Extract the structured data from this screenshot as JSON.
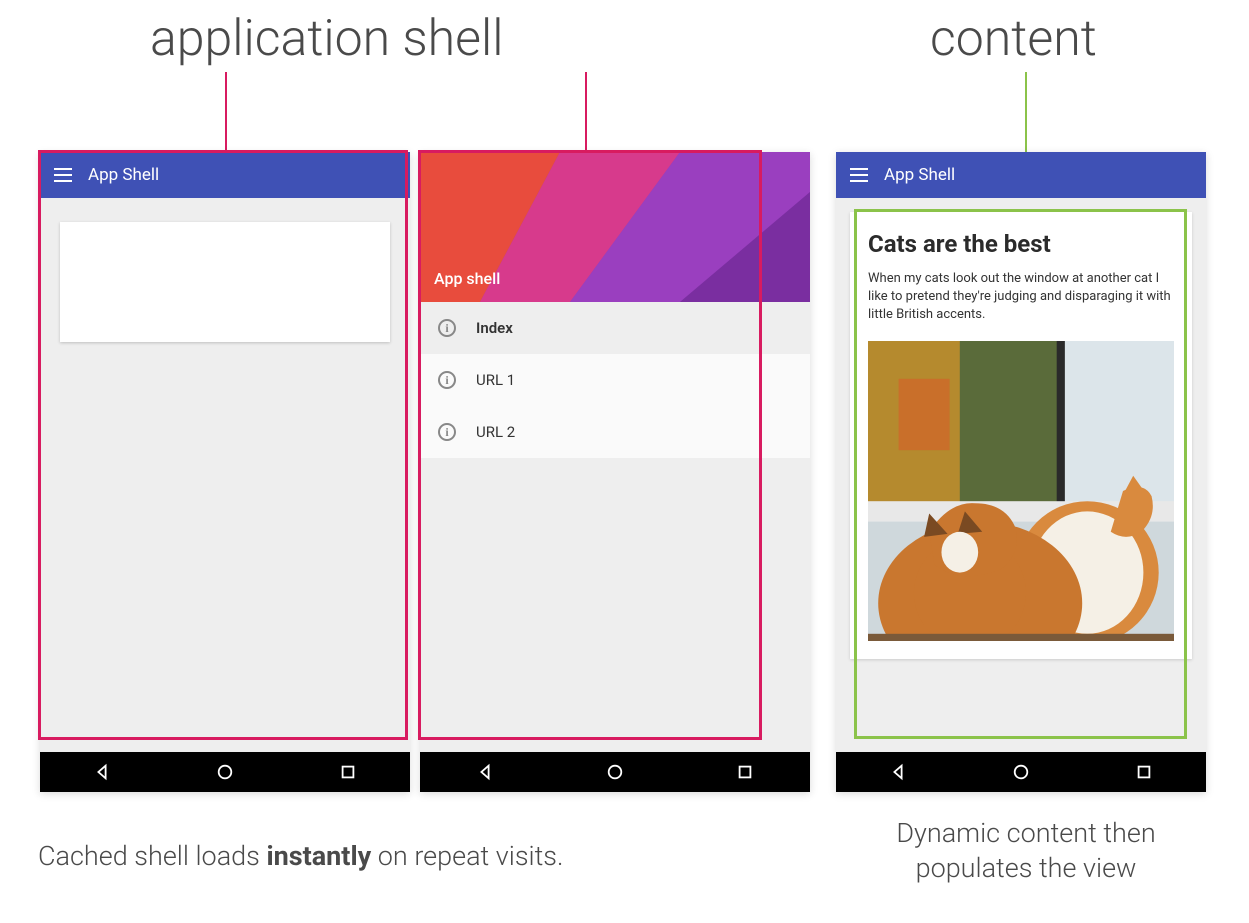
{
  "titles": {
    "shell": "application shell",
    "content": "content"
  },
  "toolbar": {
    "title": "App Shell"
  },
  "drawer": {
    "header": "App shell",
    "items": [
      {
        "label": "Index",
        "active": true
      },
      {
        "label": "URL 1",
        "active": false
      },
      {
        "label": "URL 2",
        "active": false
      }
    ]
  },
  "article": {
    "heading": "Cats are the best",
    "body": "When my cats look out the window at another cat I like to pretend they're judging and disparaging it with little British accents."
  },
  "captions": {
    "left_pre": "Cached shell loads ",
    "left_strong": "instantly",
    "left_post": " on repeat visits.",
    "right": "Dynamic content then populates the view"
  },
  "colors": {
    "shell_highlight": "#d81b60",
    "content_highlight": "#8bc34a",
    "toolbar": "#3f51b5"
  }
}
